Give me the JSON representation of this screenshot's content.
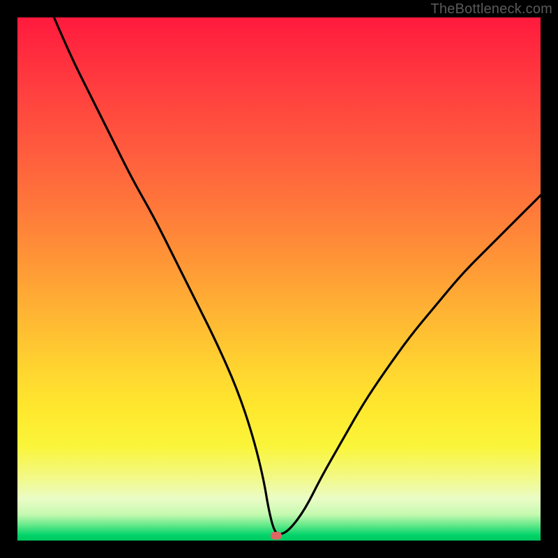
{
  "watermark": "TheBottleneck.com",
  "colors": {
    "background": "#000000",
    "marker": "#e06666",
    "curve_stroke": "#000000",
    "gradient_stops": [
      "#ff1a3d",
      "#ff3a3f",
      "#ff5a3e",
      "#ff7a3a",
      "#ff9a36",
      "#ffb933",
      "#ffd430",
      "#ffe82e",
      "#faf53a",
      "#f2f987",
      "#eafcc6",
      "#c6f9b0",
      "#66e98b",
      "#00d46a",
      "#00c75f"
    ]
  },
  "chart_data": {
    "type": "line",
    "title": "",
    "xlabel": "",
    "ylabel": "",
    "xlim": [
      0,
      100
    ],
    "ylim": [
      0,
      100
    ],
    "grid": false,
    "legend": false,
    "marker": {
      "x": 49.5,
      "y": 1.0
    },
    "series": [
      {
        "name": "bottleneck-curve",
        "x": [
          7,
          10,
          14,
          18,
          22,
          26,
          30,
          34,
          38,
          42,
          45,
          47,
          48,
          49,
          50,
          52,
          55,
          58,
          62,
          66,
          70,
          75,
          80,
          85,
          90,
          95,
          100
        ],
        "y": [
          100,
          93,
          85,
          77,
          69,
          62,
          54,
          46,
          38,
          29,
          20,
          12,
          6,
          2,
          1,
          2,
          6,
          12,
          19,
          26,
          32,
          39,
          45,
          51,
          56,
          61,
          66
        ]
      }
    ]
  }
}
